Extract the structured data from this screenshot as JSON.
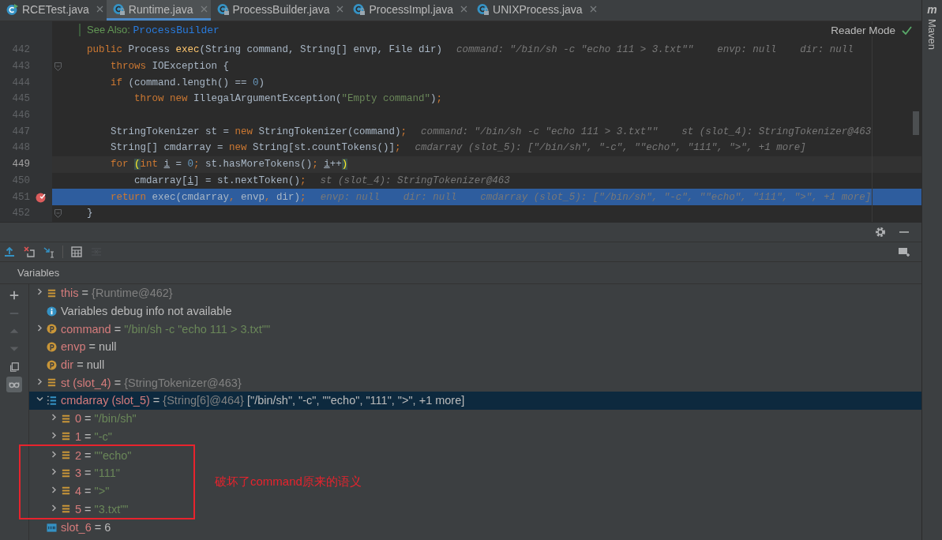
{
  "tabs": [
    {
      "label": "RCETest.java",
      "kind": "run-class",
      "selected": false
    },
    {
      "label": "Runtime.java",
      "kind": "locked-class",
      "selected": true
    },
    {
      "label": "ProcessBuilder.java",
      "kind": "locked-class",
      "selected": false
    },
    {
      "label": "ProcessImpl.java",
      "kind": "locked-class",
      "selected": false
    },
    {
      "label": "UNIXProcess.java",
      "kind": "locked-class",
      "selected": false
    }
  ],
  "reader_mode": {
    "label": "Reader Mode"
  },
  "right_bar": {
    "glyph": "m",
    "label": "Maven"
  },
  "editor": {
    "doc": {
      "prefix": "See Also:",
      "link": "ProcessBuilder"
    },
    "lines": [
      {
        "number": "442",
        "caret": false,
        "execution": false,
        "breakpoint": false,
        "fold": false,
        "tokens": [
          {
            "kind": "keyword",
            "text": "public "
          },
          {
            "kind": "plain",
            "text": "Process "
          },
          {
            "kind": "method",
            "text": "exec"
          },
          {
            "kind": "plain",
            "text": "(String command, String[] envp, File dir)"
          }
        ],
        "hints": [
          "command: \"/bin/sh -c \"echo 111 > 3.txt\"\"",
          "envp: null",
          "dir: null"
        ]
      },
      {
        "number": "443",
        "caret": false,
        "execution": false,
        "breakpoint": false,
        "fold": true,
        "tokens": [
          {
            "kind": "keyword",
            "text": "    throws "
          },
          {
            "kind": "plain",
            "text": "IOException {"
          }
        ]
      },
      {
        "number": "444",
        "caret": false,
        "execution": false,
        "breakpoint": false,
        "fold": false,
        "tokens": [
          {
            "kind": "keyword",
            "text": "    if "
          },
          {
            "kind": "plain",
            "text": "(command.length() == "
          },
          {
            "kind": "number",
            "text": "0"
          },
          {
            "kind": "plain",
            "text": ")"
          }
        ]
      },
      {
        "number": "445",
        "caret": false,
        "execution": false,
        "breakpoint": false,
        "fold": false,
        "tokens": [
          {
            "kind": "keyword",
            "text": "        throw new "
          },
          {
            "kind": "plain",
            "text": "IllegalArgumentException("
          },
          {
            "kind": "string",
            "text": "\"Empty command\""
          },
          {
            "kind": "plain",
            "text": ")"
          },
          {
            "kind": "keyword",
            "text": ";"
          }
        ]
      },
      {
        "number": "446",
        "caret": false,
        "execution": false,
        "breakpoint": false,
        "fold": false
      },
      {
        "number": "447",
        "caret": false,
        "execution": false,
        "breakpoint": false,
        "fold": false,
        "tokens": [
          {
            "kind": "plain",
            "text": "    StringTokenizer st = "
          },
          {
            "kind": "keyword",
            "text": "new "
          },
          {
            "kind": "plain",
            "text": "StringTokenizer(command)"
          },
          {
            "kind": "keyword",
            "text": ";"
          }
        ],
        "hints": [
          "command: \"/bin/sh -c \"echo 111 > 3.txt\"\"",
          "st (slot_4): StringTokenizer@463"
        ]
      },
      {
        "number": "448",
        "caret": false,
        "execution": false,
        "breakpoint": false,
        "fold": false,
        "tokens": [
          {
            "kind": "plain",
            "text": "    String[] cmdarray = "
          },
          {
            "kind": "keyword",
            "text": "new "
          },
          {
            "kind": "plain",
            "text": "String[st.countTokens()]"
          },
          {
            "kind": "keyword",
            "text": ";"
          }
        ],
        "hints": [
          "cmdarray (slot_5): [\"/bin/sh\", \"-c\", \"\"echo\", \"111\", \">\", +1 more]"
        ]
      },
      {
        "number": "449",
        "caret": true,
        "execution": false,
        "breakpoint": false,
        "fold": false,
        "tokens": [
          {
            "kind": "keyword",
            "text": "    for "
          },
          {
            "kind": "brace",
            "text": "("
          },
          {
            "kind": "keyword",
            "text": "int "
          },
          {
            "kind": "variable",
            "text": "i"
          },
          {
            "kind": "plain",
            "text": " = "
          },
          {
            "kind": "number",
            "text": "0"
          },
          {
            "kind": "keyword",
            "text": "; "
          },
          {
            "kind": "plain",
            "text": "st.hasMoreTokens()"
          },
          {
            "kind": "keyword",
            "text": "; "
          },
          {
            "kind": "variable",
            "text": "i"
          },
          {
            "kind": "plain",
            "text": "++"
          },
          {
            "kind": "brace",
            "text": ")"
          }
        ]
      },
      {
        "number": "450",
        "caret": false,
        "execution": false,
        "breakpoint": false,
        "fold": false,
        "tokens": [
          {
            "kind": "plain",
            "text": "        cmdarray["
          },
          {
            "kind": "variable",
            "text": "i"
          },
          {
            "kind": "plain",
            "text": "] = st.nextToken()"
          },
          {
            "kind": "keyword",
            "text": ";"
          }
        ],
        "hints": [
          "st (slot_4): StringTokenizer@463"
        ]
      },
      {
        "number": "451",
        "caret": false,
        "execution": true,
        "breakpoint": true,
        "fold": false,
        "tokens": [
          {
            "kind": "keyword",
            "text": "    return "
          },
          {
            "kind": "plain",
            "text": "exec(cmdarray"
          },
          {
            "kind": "keyword",
            "text": ", "
          },
          {
            "kind": "plain",
            "text": "envp"
          },
          {
            "kind": "keyword",
            "text": ", "
          },
          {
            "kind": "plain",
            "text": "dir)"
          },
          {
            "kind": "keyword",
            "text": ";"
          }
        ],
        "hints": [
          "envp: null",
          "dir: null",
          "cmdarray (slot_5): [\"/bin/sh\", \"-c\", \"\"echo\", \"111\", \">\", +1 more]"
        ]
      },
      {
        "number": "452",
        "caret": false,
        "execution": false,
        "breakpoint": false,
        "fold": true,
        "tokens": [
          {
            "kind": "plain",
            "text": "}"
          }
        ]
      }
    ]
  },
  "debug": {
    "tools": [
      {
        "kind": "step-out",
        "disabled": false
      },
      {
        "kind": "drop-frame",
        "disabled": false
      },
      {
        "kind": "run-to-cursor",
        "disabled": false
      },
      {
        "kind": "evaluate",
        "disabled": false
      },
      {
        "kind": "trace",
        "disabled": true
      }
    ],
    "side_tools": [
      {
        "kind": "add",
        "disabled": false,
        "on": false
      },
      {
        "kind": "remove",
        "disabled": true,
        "on": false
      },
      {
        "kind": "up",
        "disabled": true,
        "on": false
      },
      {
        "kind": "down",
        "disabled": true,
        "on": false
      },
      {
        "kind": "copy",
        "disabled": false,
        "on": false
      },
      {
        "kind": "glasses",
        "disabled": false,
        "on": true
      }
    ],
    "variables": {
      "title": "Variables",
      "annotation": "破坏了command原来的语义",
      "items": [
        {
          "kind": "field",
          "name": "this",
          "op": "=",
          "expanded": false,
          "selected": false,
          "value": [
            {
              "kind": "ref",
              "text": "{Runtime@462}"
            }
          ]
        },
        {
          "kind": "info",
          "text": "Variables debug info not available",
          "selected": false
        },
        {
          "kind": "param",
          "name": "command",
          "op": "=",
          "expanded": false,
          "selected": false,
          "value": [
            {
              "kind": "string",
              "text": "\"/bin/sh -c \"echo 111 > 3.txt\"\""
            }
          ]
        },
        {
          "kind": "param",
          "name": "envp",
          "op": "=",
          "selected": false,
          "value": [
            {
              "kind": "plain",
              "text": "null"
            }
          ]
        },
        {
          "kind": "param",
          "name": "dir",
          "op": "=",
          "selected": false,
          "value": [
            {
              "kind": "plain",
              "text": "null"
            }
          ]
        },
        {
          "kind": "field",
          "name": "st (slot_4)",
          "op": "=",
          "expanded": false,
          "selected": false,
          "value": [
            {
              "kind": "ref",
              "text": "{StringTokenizer@463}"
            }
          ]
        },
        {
          "kind": "array",
          "name": "cmdarray (slot_5)",
          "op": "=",
          "expanded": true,
          "selected": true,
          "value": [
            {
              "kind": "ref",
              "text": "{String[6]@464}"
            },
            {
              "kind": "plain",
              "text": "[\"/bin/sh\", \"-c\", \"\"echo\", \"111\", \">\", +1 more]"
            }
          ],
          "children": [
            {
              "kind": "field",
              "name": "0",
              "op": "=",
              "expanded": false,
              "selected": false,
              "marked": false,
              "value": [
                {
                  "kind": "string",
                  "text": "\"/bin/sh\""
                }
              ]
            },
            {
              "kind": "field",
              "name": "1",
              "op": "=",
              "expanded": false,
              "selected": false,
              "marked": false,
              "value": [
                {
                  "kind": "string",
                  "text": "\"-c\""
                }
              ]
            },
            {
              "kind": "field",
              "name": "2",
              "op": "=",
              "expanded": false,
              "selected": false,
              "marked": true,
              "value": [
                {
                  "kind": "string",
                  "text": "\"\"echo\""
                }
              ]
            },
            {
              "kind": "field",
              "name": "3",
              "op": "=",
              "expanded": false,
              "selected": false,
              "marked": true,
              "value": [
                {
                  "kind": "string",
                  "text": "\"111\""
                }
              ]
            },
            {
              "kind": "field",
              "name": "4",
              "op": "=",
              "expanded": false,
              "selected": false,
              "marked": true,
              "value": [
                {
                  "kind": "string",
                  "text": "\">\""
                }
              ]
            },
            {
              "kind": "field",
              "name": "5",
              "op": "=",
              "expanded": false,
              "selected": false,
              "marked": true,
              "value": [
                {
                  "kind": "string",
                  "text": "\"3.txt\"\""
                }
              ]
            }
          ]
        },
        {
          "kind": "primitive",
          "name": "slot_6",
          "op": "=",
          "selected": false,
          "value": [
            {
              "kind": "plain",
              "text": "6"
            }
          ]
        }
      ]
    }
  }
}
